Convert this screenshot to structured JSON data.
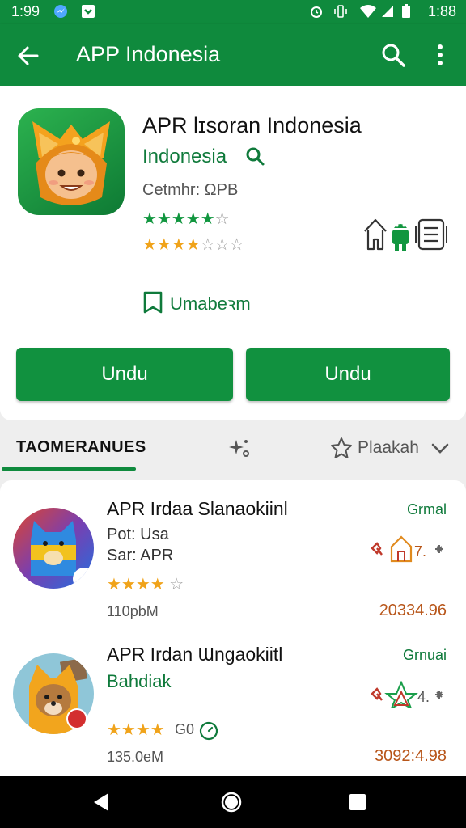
{
  "status_bar": {
    "time_left": "1:99",
    "time_right": "1:88"
  },
  "app_bar": {
    "title": "APP Indonesia",
    "icons": [
      "back-arrow-icon",
      "search-icon",
      "more-vert-icon"
    ]
  },
  "app": {
    "name": "APR lɪsoran Indonesia",
    "developer": "Indonesia",
    "meta": "Cetmhr: ΩPB",
    "rating_green": 4.5,
    "rating_orange": 3.5,
    "wishlist_label": "Umabeꝛm",
    "install_button_1": "Undu",
    "install_button_2": "Undu"
  },
  "section": {
    "title": "TAOMERANUES",
    "sort_label": "Plaakah"
  },
  "list_items": [
    {
      "title": "APR Irdaa Slanaokiinl",
      "line2": "Pot: Usa",
      "line3": "Sar: APR",
      "rating": 4,
      "size": "110pbM",
      "status": "Grmal",
      "rank_text": "7.",
      "price": "20334.96"
    },
    {
      "title": "APR Irdan Ɯngaokiitl",
      "subtitle": "Bahdiak",
      "rating": 4,
      "rating_count": "G0",
      "size": "135.0eM",
      "status": "Grnuai",
      "rank_text": "4.",
      "price": "3092:4.98"
    }
  ],
  "colors": {
    "primary": "#0f8a3d",
    "star_green": "#11963f",
    "star_orange": "#f0a31a",
    "price": "#b8561a"
  }
}
